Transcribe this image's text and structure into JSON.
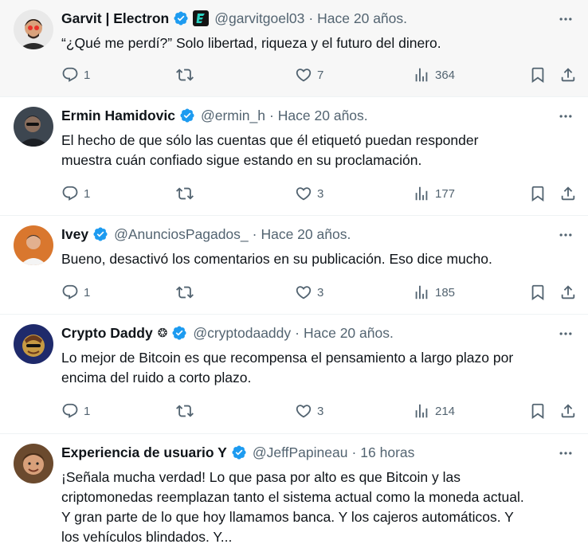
{
  "tweets": [
    {
      "name": "Garvit | Electron",
      "handle": "@garvitgoel03",
      "time": "Hace 20 años.",
      "text": "“¿Qué me perdí?” Solo libertad, riqueza y el futuro del dinero.",
      "replies": "1",
      "retweets": "",
      "likes": "7",
      "views": "364",
      "highlight": true,
      "extra_badge": "electron-logo-icon"
    },
    {
      "name": "Ermin Hamidovic",
      "handle": "@ermin_h",
      "time": "Hace 20 años.",
      "text": "El hecho de que sólo las cuentas que él etiquetó puedan responder\nmuestra cuán confiado sigue estando en su proclamación.",
      "replies": "1",
      "retweets": "",
      "likes": "3",
      "views": "177"
    },
    {
      "name": "Ivey",
      "handle": "@AnunciosPagados_",
      "time": "Hace 20 años.",
      "text": "Bueno, desactivó los comentarios en su publicación. Eso dice mucho.",
      "replies": "1",
      "retweets": "",
      "likes": "3",
      "views": "185"
    },
    {
      "name": "Crypto Daddy",
      "handle": "@cryptodaaddy",
      "time": "Hace 20 años.",
      "text": "Lo mejor de Bitcoin es que recompensa el pensamiento a largo plazo por\nencima del ruido a corto plazo.",
      "replies": "1",
      "retweets": "",
      "likes": "3",
      "views": "214",
      "name_emoji": "❂"
    },
    {
      "name": "Experiencia de usuario Y",
      "handle": "@JeffPapineau",
      "time": "16 horas",
      "text": "¡Señala mucha verdad! Lo que pasa por alto es que Bitcoin y las\ncriptomonedas reemplazan tanto el sistema actual como la moneda actual.\nY gran parte de lo que hoy llamamos banca. Y los cajeros automáticos. Y\nlos vehículos blindados. Y..."
    }
  ],
  "icons": {
    "verified": "verified-badge-icon",
    "more": "more-icon",
    "reply": "reply-icon",
    "retweet": "retweet-icon",
    "like": "like-icon",
    "views": "views-icon",
    "bookmark": "bookmark-icon",
    "share": "share-icon"
  },
  "colors": {
    "verified": "#1d9bf0",
    "secondary_text": "#536471",
    "primary_text": "#0f1419",
    "highlight_bg": "#f7f7f7"
  }
}
